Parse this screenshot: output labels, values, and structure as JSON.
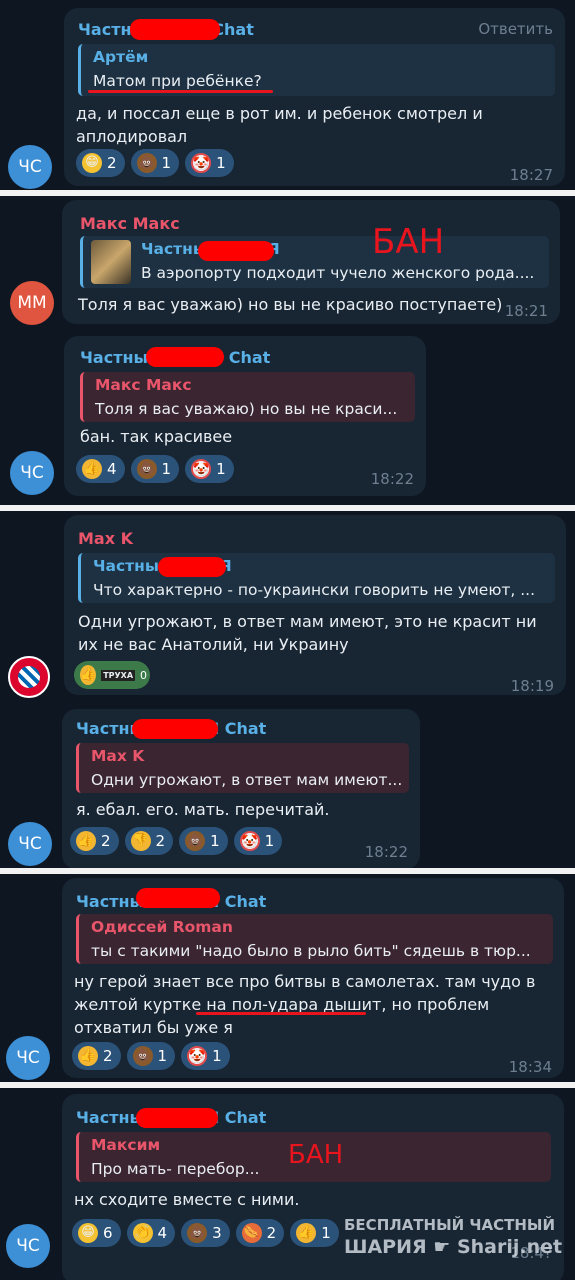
{
  "colors": {
    "background": "#0e1621",
    "bubble": "#182533",
    "accent_blue": "#59b0e6",
    "accent_red": "#e9556a",
    "redaction": "#ff0000",
    "pill": "#2b5278",
    "time": "#6d7f91"
  },
  "m1": {
    "avatar": "ЧС",
    "sender": "Частн   ШАРИЯ Chat",
    "reply": "Ответить",
    "quote_name": "Артём",
    "quote_text": "Матом при ребёнке?",
    "text": "да, и поссал еще в рот им. и ребенок смотрел и аплодировал",
    "reactions": [
      {
        "icon": "grin-emoji",
        "count": "2"
      },
      {
        "icon": "poo-emoji",
        "count": "1"
      },
      {
        "icon": "clown-emoji",
        "count": "1"
      }
    ],
    "time": "18:27"
  },
  "m2": {
    "avatar": "ММ",
    "sender": "Макс Макс",
    "quote_name": "Частны   ШАРИЯ",
    "quote_text": "В аэропорту подходит чучело женского рода....",
    "text": "Толя я вас уважаю) но вы не красиво поступаете)",
    "time": "18:21",
    "ban": "БАН"
  },
  "m3": {
    "avatar": "ЧС",
    "sender": "Частны   ШАРИЯ Chat",
    "quote_name": "Макс Макс",
    "quote_text": "Толя я вас уважаю) но вы не краси...",
    "text": "бан. так красивее",
    "reactions": [
      {
        "icon": "thumbs-up-emoji",
        "count": "4"
      },
      {
        "icon": "poo-emoji",
        "count": "1"
      },
      {
        "icon": "clown-emoji",
        "count": "1"
      }
    ],
    "time": "18:22"
  },
  "m4": {
    "avatar": "FC BAYERN MÜNCHEN",
    "sender": "Max K",
    "quote_name": "Частны   ШАРИЯ",
    "quote_text": "Что характерно - по-украински говорить не умеют, ...",
    "text": "Одни угрожают, в ответ мам имеют, это не красит ни их не вас Анатолий, ни Украину",
    "reaction_tag": "ТРУХА",
    "reaction_count": "0",
    "time": "18:19"
  },
  "m5": {
    "avatar": "ЧС",
    "sender": "Частны   ШАРИЯ Chat",
    "quote_name": "Max K",
    "quote_text": "Одни угрожают, в ответ мам имеют...",
    "text": "я. ебал. его. мать. перечитай.",
    "reactions": [
      {
        "icon": "thumbs-up-emoji",
        "count": "2"
      },
      {
        "icon": "thumbs-down-emoji",
        "count": "2"
      },
      {
        "icon": "poo-emoji",
        "count": "1"
      },
      {
        "icon": "clown-emoji",
        "count": "1"
      }
    ],
    "time": "18:22"
  },
  "m6": {
    "avatar": "ЧС",
    "sender": "Частны   ШАРИЯ Chat",
    "quote_name": "Одиссей Roman",
    "quote_text": "ты с такими \"надо было в рыло бить\" сядешь в тюр...",
    "line1": "ну герой знает все про битвы в самолетах. там чудо в",
    "line2a": "желтой куртке ",
    "line2b": "на пол-удара дышит",
    "line2c": ", но проблем",
    "line3": "отхватил бы уже я",
    "reactions": [
      {
        "icon": "thumbs-up-emoji",
        "count": "2"
      },
      {
        "icon": "poo-emoji",
        "count": "1"
      },
      {
        "icon": "clown-emoji",
        "count": "1"
      }
    ],
    "time": "18:34"
  },
  "m7": {
    "avatar": "ЧС",
    "sender": "Частны   ШАРИЯ Chat",
    "quote_name": "Максим",
    "quote_text": "Про мать- перебор...",
    "text": "нх сходите вместе с ними.",
    "ban": "БАН",
    "reactions": [
      {
        "icon": "grin-emoji",
        "count": "6"
      },
      {
        "icon": "clap-emoji",
        "count": "4"
      },
      {
        "icon": "poo-emoji",
        "count": "3"
      },
      {
        "icon": "hotdog-emoji",
        "count": "2"
      },
      {
        "icon": "thumbs-up-emoji",
        "count": "1"
      }
    ],
    "time": "18:4?"
  },
  "watermark": {
    "line1": "БЕСПЛАТНЫЙ ЧАСТНЫЙ",
    "line2": "ШАРИЯ",
    "site": "Sharij.net"
  }
}
